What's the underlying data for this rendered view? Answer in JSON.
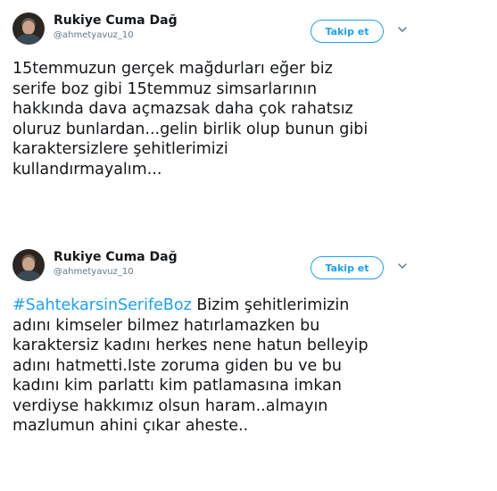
{
  "tweets": [
    {
      "user": {
        "name": "Rukiye Cuma Dağ",
        "handle": "@ahmetyavuz_10"
      },
      "follow_label": "Takip et",
      "lines": [
        "15temmuzun gerçek mağdurları eğer biz",
        "serife boz gibi 15temmuz simsarlarının",
        "hakkında dava açmazsak daha çok rahatsız",
        "oluruz bunlardan...gelin birlik olup bunun gibi",
        "karaktersizlere şehitlerimizi",
        "kullandırmayalım..."
      ]
    },
    {
      "user": {
        "name": "Rukiye Cuma Dağ",
        "handle": "@ahmetyavuz_10"
      },
      "follow_label": "Takip et",
      "hashtag": "#SahtekarsinSerifeBoz",
      "first_line_rest": " Bizim şehitlerimizin",
      "lines": [
        "adını kimseler bilmez hatırlamazken bu",
        "karaktersiz kadını herkes nene hatun belleyip",
        "adını hatmetti.Iste zoruma giden bu ve bu",
        "kadını kim parlattı kim patlamasına imkan",
        "verdiyse hakkımız olsun haram..almayın",
        "mazlumun ahini çıkar aheste.."
      ]
    }
  ],
  "icons": {
    "avatar": "user-avatar",
    "more": "chevron-down-icon"
  },
  "colors": {
    "accent": "#1da1f2",
    "text": "#14171a",
    "muted": "#657786"
  }
}
